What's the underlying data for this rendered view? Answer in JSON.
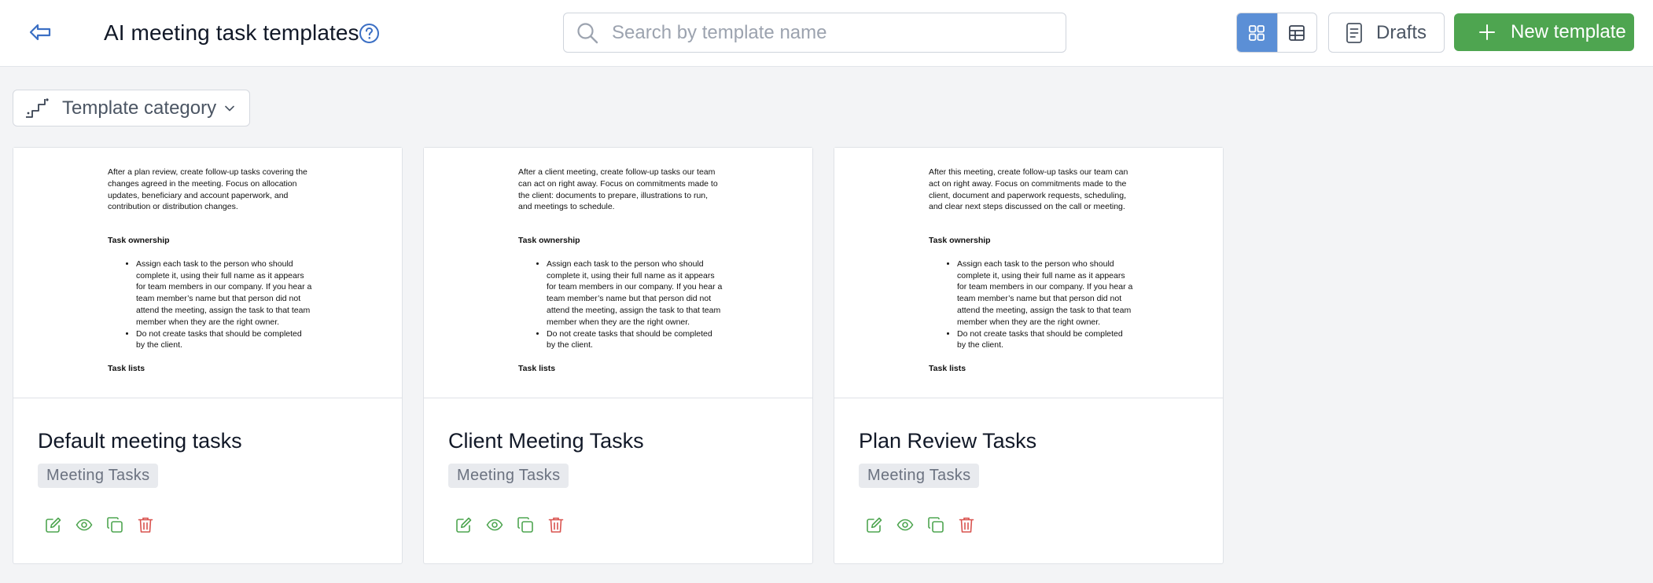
{
  "header": {
    "title": "AI meeting task templates",
    "back_icon": "back-arrow-icon",
    "help_icon": "help-circle-icon"
  },
  "search": {
    "placeholder": "Search by template name",
    "value": ""
  },
  "view_toggle": {
    "options": [
      "grid-view",
      "table-view"
    ],
    "active": "grid-view",
    "active_color": "#5b8fd6"
  },
  "toolbar": {
    "drafts_label": "Drafts",
    "new_template_label": "New template",
    "new_template_color": "#4ea550"
  },
  "filter": {
    "category_label": "Template category"
  },
  "cards": [
    {
      "title": "Default meeting tasks",
      "tag": "Meeting Tasks",
      "preview": {
        "intro": "After a plan review, create follow-up tasks covering the changes agreed in the meeting. Focus on allocation updates, beneficiary and account paperwork, and contribution or distribution changes.",
        "heading1": "Task ownership",
        "bullets": [
          "Assign each task to the person who should complete it, using their full name as it appears for team members in our company. If you hear a team member’s name but that person did not attend the meeting, assign the task to that team member when they are the right owner.",
          "Do not create tasks that should be completed by the client."
        ],
        "heading2": "Task lists"
      }
    },
    {
      "title": "Client Meeting Tasks",
      "tag": "Meeting Tasks",
      "preview": {
        "intro": "After a client meeting, create follow-up tasks our team can act on right away. Focus on commitments made to the client: documents to prepare, illustrations to run, and meetings to schedule.",
        "heading1": "Task ownership",
        "bullets": [
          "Assign each task to the person who should complete it, using their full name as it appears for team members in our company. If you hear a team member’s name but that person did not attend the meeting, assign the task to that team member when they are the right owner.",
          "Do not create tasks that should be completed by the client."
        ],
        "heading2": "Task lists"
      }
    },
    {
      "title": "Plan Review Tasks",
      "tag": "Meeting Tasks",
      "preview": {
        "intro": "After this meeting, create follow-up tasks our team can act on right away. Focus on commitments made to the client, document and paperwork requests, scheduling, and clear next steps discussed on the call or meeting.",
        "heading1": "Task ownership",
        "bullets": [
          "Assign each task to the person who should complete it, using their full name as it appears for team members in our company. If you hear a team member’s name but that person did not attend the meeting, assign the task to that team member when they are the right owner.",
          "Do not create tasks that should be completed by the client."
        ],
        "heading2": "Task lists"
      }
    }
  ],
  "card_actions": {
    "icons": [
      "edit-icon",
      "view-icon",
      "duplicate-icon",
      "delete-icon"
    ],
    "action_color": "#4ea550",
    "delete_color": "#d9534f"
  }
}
